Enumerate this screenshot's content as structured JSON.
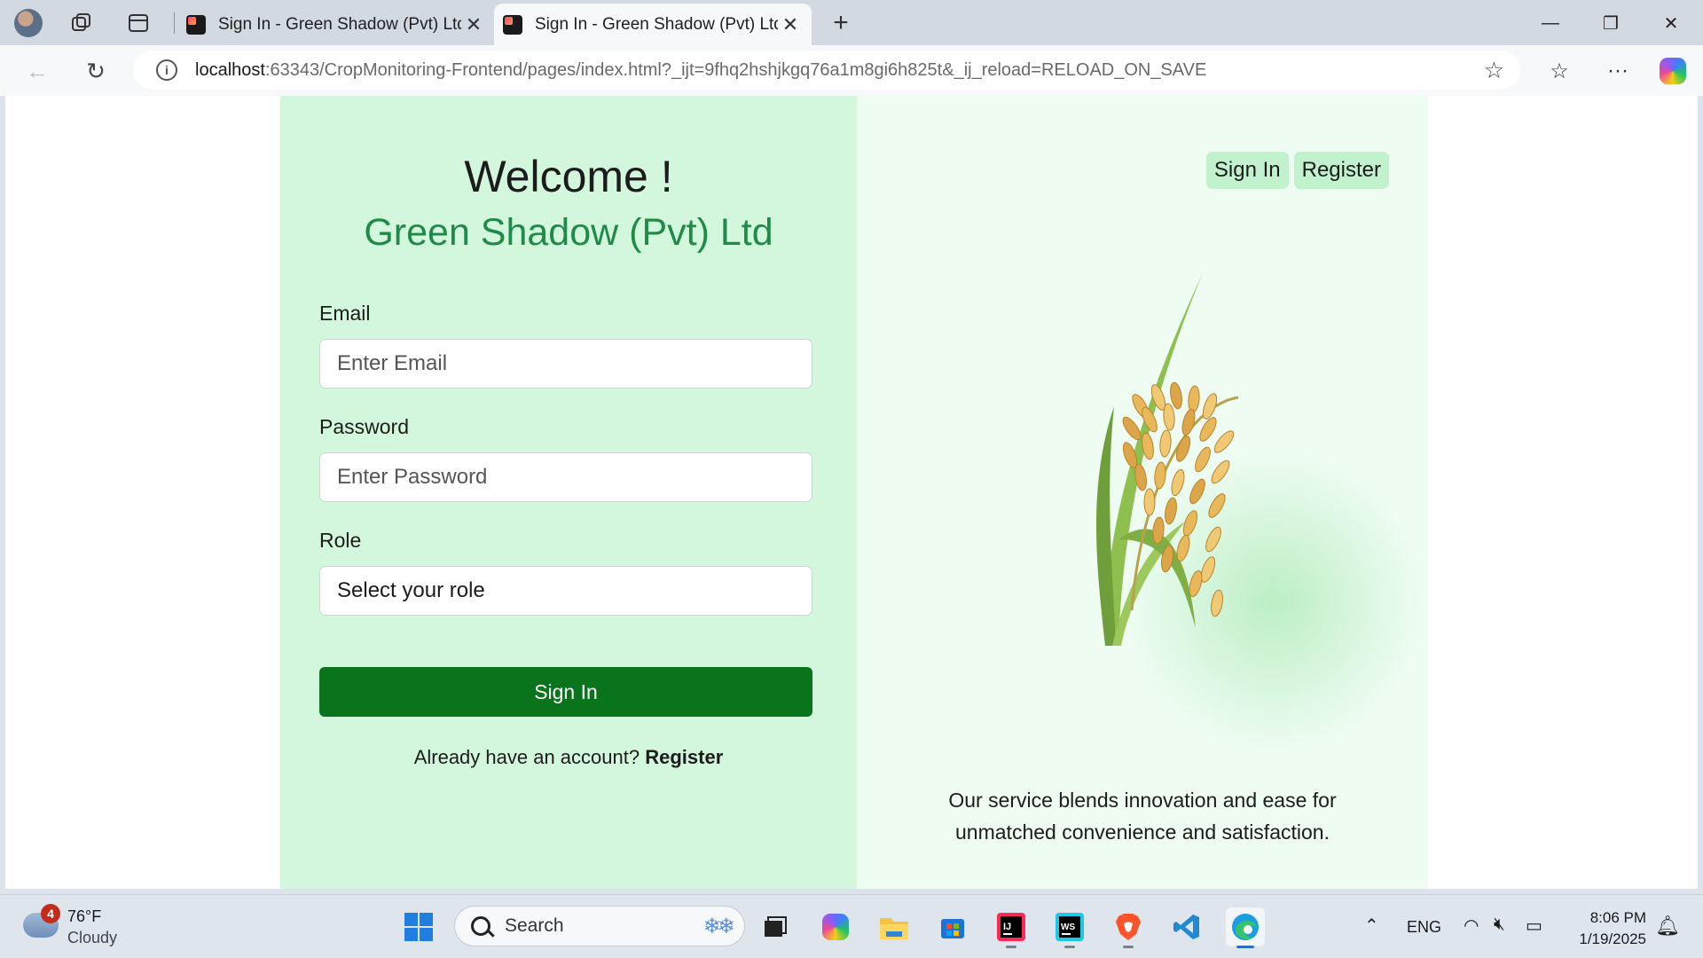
{
  "browser": {
    "tabs": [
      {
        "title": "Sign In - Green Shadow (Pvt) Ltd",
        "active": false
      },
      {
        "title": "Sign In - Green Shadow (Pvt) Ltd",
        "active": true
      }
    ],
    "address": {
      "host": "localhost",
      "rest": ":63343/CropMonitoring-Frontend/pages/index.html?_ijt=9fhq2hshjkgq76a1m8gi6h825t&_ij_reload=RELOAD_ON_SAVE"
    }
  },
  "page": {
    "welcome": "Welcome !",
    "company": "Green Shadow (Pvt) Ltd",
    "form": {
      "email_label": "Email",
      "email_placeholder": "Enter Email",
      "password_label": "Password",
      "password_placeholder": "Enter Password",
      "role_label": "Role",
      "role_selected": "Select your role",
      "submit_label": "Sign In",
      "account_prompt": "Already have an account?",
      "account_link": "Register"
    },
    "nav": {
      "signin": "Sign In",
      "register": "Register"
    },
    "tagline_line1": "Our service blends innovation and ease for",
    "tagline_line2": "unmatched convenience and satisfaction.",
    "colors": {
      "left_panel": "#d3f7dc",
      "right_panel": "#eefcf2",
      "brand_green": "#1f8a4a",
      "button_green": "#0a741c"
    }
  },
  "taskbar": {
    "weather_badge": "4",
    "weather_temp": "76°F",
    "weather_desc": "Cloudy",
    "search_placeholder": "Search",
    "language": "ENG",
    "time": "8:06 PM",
    "date": "1/19/2025",
    "icons": [
      "start-icon",
      "search-icon",
      "task-view-icon",
      "copilot-icon",
      "file-explorer-icon",
      "store-icon",
      "intellij-icon",
      "webstorm-icon",
      "brave-icon",
      "vscode-icon",
      "edge-icon"
    ]
  }
}
